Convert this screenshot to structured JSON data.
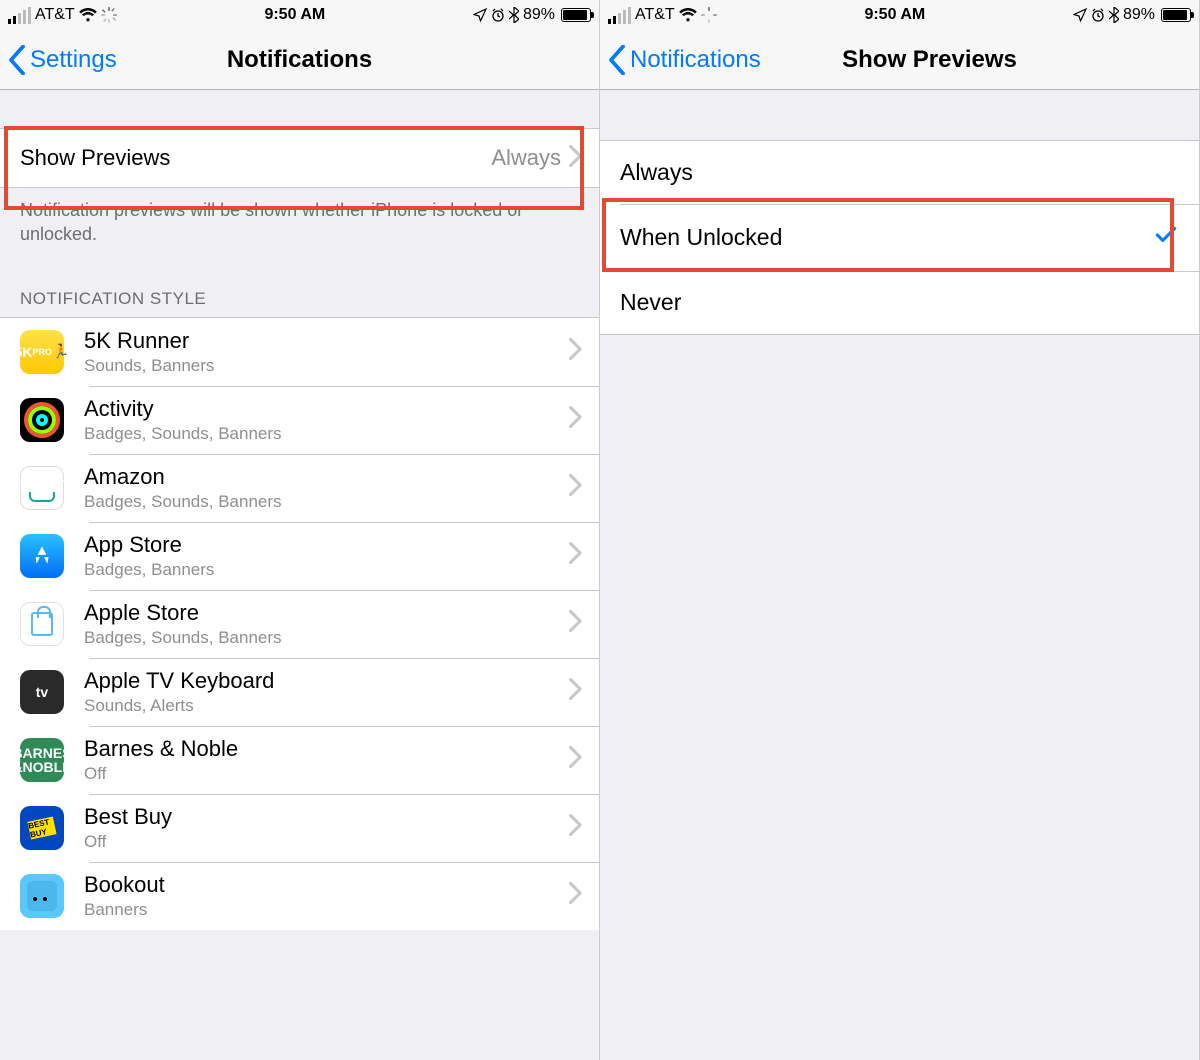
{
  "status": {
    "carrier": "AT&T",
    "time": "9:50 AM",
    "battery_pct": "89%"
  },
  "left": {
    "back_label": "Settings",
    "title": "Notifications",
    "show_previews": {
      "label": "Show Previews",
      "value": "Always"
    },
    "footer": "Notification previews will be shown whether iPhone is locked or unlocked.",
    "style_header": "NOTIFICATION STYLE",
    "apps": [
      {
        "name": "5K Runner",
        "detail": "Sounds, Banners"
      },
      {
        "name": "Activity",
        "detail": "Badges, Sounds, Banners"
      },
      {
        "name": "Amazon",
        "detail": "Badges, Sounds, Banners"
      },
      {
        "name": "App Store",
        "detail": "Badges, Banners"
      },
      {
        "name": "Apple Store",
        "detail": "Badges, Sounds, Banners"
      },
      {
        "name": "Apple TV Keyboard",
        "detail": "Sounds, Alerts"
      },
      {
        "name": "Barnes & Noble",
        "detail": "Off"
      },
      {
        "name": "Best Buy",
        "detail": "Off"
      },
      {
        "name": "Bookout",
        "detail": "Banners"
      }
    ]
  },
  "right": {
    "back_label": "Notifications",
    "title": "Show Previews",
    "options": [
      {
        "label": "Always",
        "selected": false
      },
      {
        "label": "When Unlocked",
        "selected": true
      },
      {
        "label": "Never",
        "selected": false
      }
    ]
  }
}
